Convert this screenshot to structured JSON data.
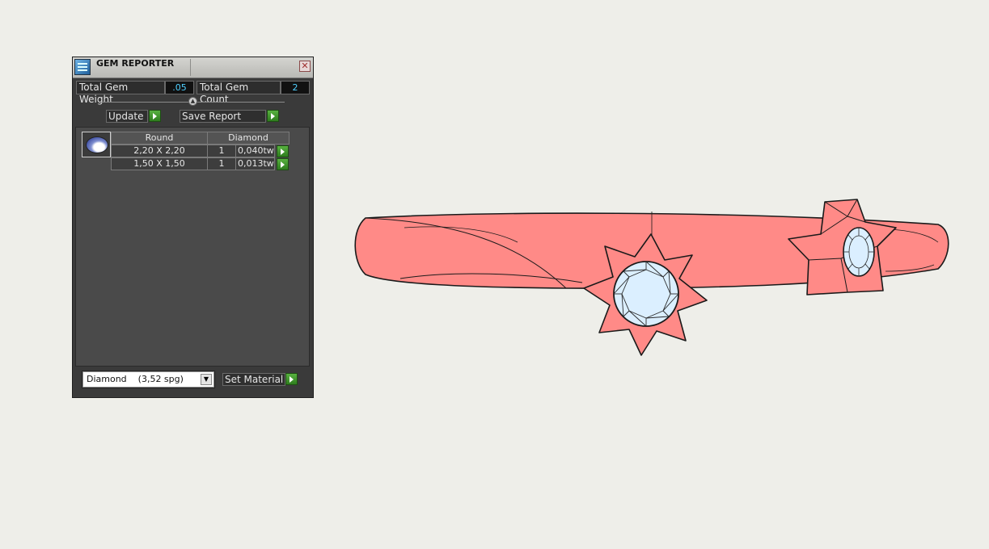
{
  "panel": {
    "title": "GEM REPORTER",
    "close_glyph": "✕",
    "total_weight_label": "Total Gem Weight",
    "total_weight_value": ".05",
    "total_count_label": "Total Gem Count",
    "total_count_value": "2",
    "update_label": "Update",
    "save_report_label": "Save Report",
    "table": {
      "headers": [
        "Round",
        "Diamond"
      ],
      "rows": [
        {
          "size": "2,20 X 2,20",
          "count": "1",
          "weight": "0,040tw"
        },
        {
          "size": "1,50 X 1,50",
          "count": "1",
          "weight": "0,013tw"
        }
      ]
    },
    "material_select": "Diamond    (3,52 spg)",
    "set_material_label": "Set Material"
  },
  "icons": {
    "title": "gem-reporter-icon",
    "close": "close-icon",
    "gem": "round-gem-icon",
    "go": "green-arrow-icon",
    "dropdown": "chevron-down-icon"
  },
  "colors": {
    "panel_bg": "#3a3a3a",
    "value_text": "#4fd0ff",
    "go_button": "#3f9a2c",
    "ring_metal": "#ff8a87",
    "gem": "#dbefff",
    "viewport_bg": "#eeeee9"
  }
}
